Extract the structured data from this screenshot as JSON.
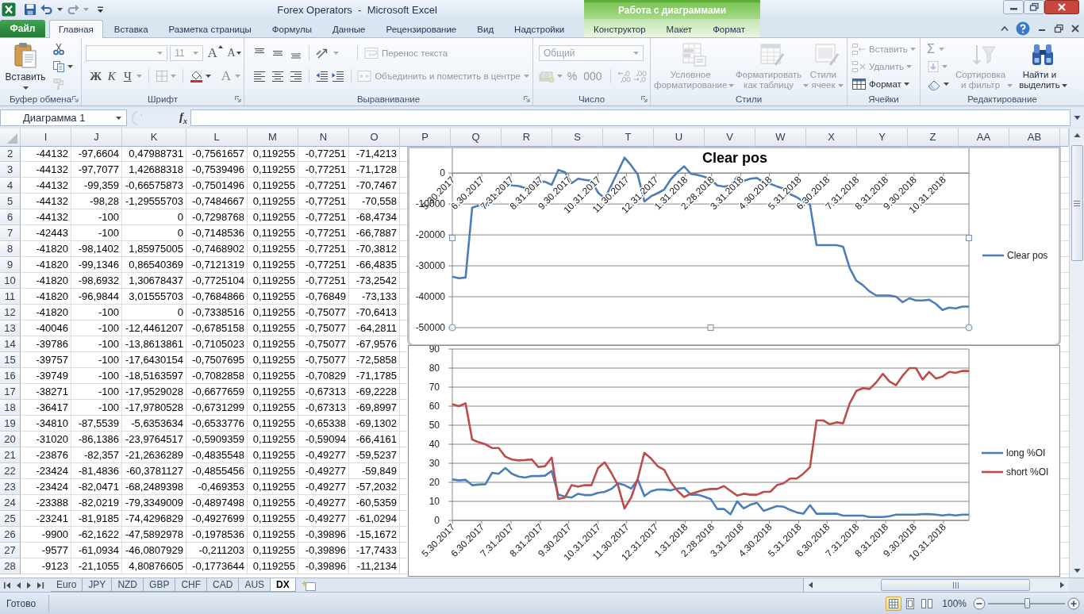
{
  "window": {
    "title": "Forex Operators  -  Microsoft Excel"
  },
  "chart_tools": {
    "title": "Работа с диаграммами",
    "tabs": [
      {
        "label": "Конструктор",
        "selected": false
      },
      {
        "label": "Макет",
        "selected": false
      },
      {
        "label": "Формат",
        "selected": false
      }
    ]
  },
  "tabs": [
    {
      "label": "Файл",
      "kind": "file",
      "selected": false
    },
    {
      "label": "Главная",
      "kind": "tab",
      "selected": true
    },
    {
      "label": "Вставка",
      "kind": "tab",
      "selected": false
    },
    {
      "label": "Разметка страницы",
      "kind": "tab",
      "selected": false
    },
    {
      "label": "Формулы",
      "kind": "tab",
      "selected": false
    },
    {
      "label": "Данные",
      "kind": "tab",
      "selected": false
    },
    {
      "label": "Рецензирование",
      "kind": "tab",
      "selected": false
    },
    {
      "label": "Вид",
      "kind": "tab",
      "selected": false
    },
    {
      "label": "Надстройки",
      "kind": "tab",
      "selected": false
    }
  ],
  "ribbon": {
    "clipboard": {
      "title": "Буфер обмена",
      "paste": "Вставить"
    },
    "font": {
      "title": "Шрифт",
      "size": {
        "value": "11",
        "disabled": true
      },
      "grow": "A",
      "shrink": "A",
      "styles": [
        {
          "label": "Ж",
          "kind": "bold"
        },
        {
          "label": "К",
          "kind": "italic"
        },
        {
          "label": "Ч",
          "kind": "underline"
        }
      ],
      "font_color_button": {
        "label": "A"
      }
    },
    "alignment": {
      "title": "Выравнивание",
      "wrap": {
        "label": "Перенос текста",
        "disabled": true
      },
      "merge": {
        "label": "Объединить и поместить в центре",
        "disabled": true
      }
    },
    "number": {
      "title": "Число",
      "format": {
        "value": "Общий",
        "disabled": true
      },
      "percent": {
        "label": "%",
        "disabled": true
      },
      "thousands": {
        "label": "000",
        "disabled": true
      }
    },
    "styles": {
      "title": "Стили",
      "buttons": [
        {
          "label": "Условное форматирование",
          "kind": "conditional",
          "disabled": true
        },
        {
          "label": "Форматировать как таблицу",
          "kind": "table",
          "disabled": true
        },
        {
          "label": "Стили ячеек",
          "kind": "cell_styles",
          "disabled": true
        }
      ]
    },
    "cells": {
      "title": "Ячейки",
      "buttons": [
        {
          "label": "Вставить",
          "kind": "insert",
          "disabled": true
        },
        {
          "label": "Удалить",
          "kind": "delete",
          "disabled": true
        },
        {
          "label": "Формат",
          "kind": "format",
          "disabled": false
        }
      ]
    },
    "editing": {
      "title": "Редактирование",
      "sum": {
        "label": "Σ",
        "disabled": true
      },
      "buttons": [
        {
          "label": "Сортировка и фильтр",
          "kind": "sort",
          "disabled": true
        },
        {
          "label": "Найти и выделить",
          "kind": "find",
          "disabled": false
        }
      ]
    }
  },
  "formula_bar": {
    "name_box": "Диаграмма 1",
    "function_label": "f$_{x}$"
  },
  "sheet": {
    "columns": [
      "I",
      "J",
      "K",
      "L",
      "M",
      "N",
      "O",
      "P",
      "Q",
      "R",
      "S",
      "T",
      "U",
      "V",
      "W",
      "X",
      "Y",
      "Z",
      "AA",
      "AB"
    ],
    "rows": [
      {
        "header": "2",
        "cells": [
          "-44132",
          "-97,6604",
          "0,47988731",
          "-0,7561657",
          "0,119255",
          "-0,77251",
          "-71,4213"
        ]
      },
      {
        "header": "3",
        "cells": [
          "-44132",
          "-97,7077",
          "1,42688318",
          "-0,7539496",
          "0,119255",
          "-0,77251",
          "-71,1728"
        ]
      },
      {
        "header": "4",
        "cells": [
          "-44132",
          "-99,359",
          "-0,66575873",
          "-0,7501496",
          "0,119255",
          "-0,77251",
          "-70,7467"
        ]
      },
      {
        "header": "5",
        "cells": [
          "-44132",
          "-98,28",
          "-1,29555703",
          "-0,7484667",
          "0,119255",
          "-0,77251",
          "-70,558"
        ]
      },
      {
        "header": "6",
        "cells": [
          "-44132",
          "-100",
          "0",
          "-0,7298768",
          "0,119255",
          "-0,77251",
          "-68,4734"
        ]
      },
      {
        "header": "7",
        "cells": [
          "-42443",
          "-100",
          "0",
          "-0,7148536",
          "0,119255",
          "-0,77251",
          "-66,7887"
        ]
      },
      {
        "header": "8",
        "cells": [
          "-41820",
          "-98,1402",
          "1,85975005",
          "-0,7468902",
          "0,119255",
          "-0,77251",
          "-70,3812"
        ]
      },
      {
        "header": "9",
        "cells": [
          "-41820",
          "-99,1346",
          "0,86540369",
          "-0,7121319",
          "0,119255",
          "-0,77251",
          "-66,4835"
        ]
      },
      {
        "header": "10",
        "cells": [
          "-41820",
          "-98,6932",
          "1,30678437",
          "-0,7725104",
          "0,119255",
          "-0,77251",
          "-73,2542"
        ]
      },
      {
        "header": "11",
        "cells": [
          "-41820",
          "-96,9844",
          "3,01555703",
          "-0,7684866",
          "0,119255",
          "-0,76849",
          "-73,133"
        ]
      },
      {
        "header": "12",
        "cells": [
          "-41820",
          "-100",
          "0",
          "-0,7338516",
          "0,119255",
          "-0,75077",
          "-70,6413"
        ]
      },
      {
        "header": "13",
        "cells": [
          "-40046",
          "-100",
          "-12,4461207",
          "-0,6785158",
          "0,119255",
          "-0,75077",
          "-64,2811"
        ]
      },
      {
        "header": "14",
        "cells": [
          "-39786",
          "-100",
          "-13,8613861",
          "-0,7105023",
          "0,119255",
          "-0,75077",
          "-67,9576"
        ]
      },
      {
        "header": "15",
        "cells": [
          "-39757",
          "-100",
          "-17,6430154",
          "-0,7507695",
          "0,119255",
          "-0,75077",
          "-72,5858"
        ]
      },
      {
        "header": "16",
        "cells": [
          "-39749",
          "-100",
          "-18,5163597",
          "-0,7082858",
          "0,119255",
          "-0,70829",
          "-71,1785"
        ]
      },
      {
        "header": "17",
        "cells": [
          "-38271",
          "-100",
          "-17,9529028",
          "-0,6677659",
          "0,119255",
          "-0,67313",
          "-69,2228"
        ]
      },
      {
        "header": "18",
        "cells": [
          "-36417",
          "-100",
          "-17,9780528",
          "-0,6731299",
          "0,119255",
          "-0,67313",
          "-69,8997"
        ]
      },
      {
        "header": "19",
        "cells": [
          "-34810",
          "-87,5539",
          "-5,6353634",
          "-0,6533776",
          "0,119255",
          "-0,65338",
          "-69,1302"
        ]
      },
      {
        "header": "20",
        "cells": [
          "-31020",
          "-86,1386",
          "-23,9764517",
          "-0,5909359",
          "0,119255",
          "-0,59094",
          "-66,4161"
        ]
      },
      {
        "header": "21",
        "cells": [
          "-23876",
          "-82,357",
          "-21,2636289",
          "-0,4835548",
          "0,119255",
          "-0,49277",
          "-59,5237"
        ]
      },
      {
        "header": "22",
        "cells": [
          "-23424",
          "-81,4836",
          "-60,3781127",
          "-0,4855456",
          "0,119255",
          "-0,49277",
          "-59,849"
        ]
      },
      {
        "header": "23",
        "cells": [
          "-23424",
          "-82,0471",
          "-68,2489398",
          "-0,469353",
          "0,119255",
          "-0,49277",
          "-57,2032"
        ]
      },
      {
        "header": "24",
        "cells": [
          "-23388",
          "-82,0219",
          "-79,3349009",
          "-0,4897498",
          "0,119255",
          "-0,49277",
          "-60,5359"
        ]
      },
      {
        "header": "25",
        "cells": [
          "-23241",
          "-81,9185",
          "-74,4296829",
          "-0,4927699",
          "0,119255",
          "-0,49277",
          "-61,0294"
        ]
      },
      {
        "header": "26",
        "cells": [
          "-9900",
          "-62,1622",
          "-47,5892978",
          "-0,1978536",
          "0,119255",
          "-0,39896",
          "-15,1672"
        ]
      },
      {
        "header": "27",
        "cells": [
          "-9577",
          "-61,0934",
          "-46,0807929",
          "-0,211203",
          "0,119255",
          "-0,39896",
          "-17,7433"
        ]
      },
      {
        "header": "28",
        "cells": [
          "-9123",
          "-21,1055",
          "4,80876605",
          "-0,1773644",
          "0,119255",
          "-0,39896",
          "-11,2134"
        ]
      }
    ],
    "charts": [
      {
        "selected": true,
        "chart_data": {
          "type": "line",
          "title": "Clear pos",
          "grid": true,
          "legend": "right",
          "x": [
            "2017-05-30",
            "2017-06-06",
            "2017-06-13",
            "2017-06-20",
            "2017-06-27",
            "2017-07-04",
            "2017-07-11",
            "2017-07-18",
            "2017-07-25",
            "2017-08-01",
            "2017-08-08",
            "2017-08-15",
            "2017-08-22",
            "2017-08-29",
            "2017-09-05",
            "2017-09-12",
            "2017-09-19",
            "2017-09-26",
            "2017-10-03",
            "2017-10-10",
            "2017-10-17",
            "2017-10-24",
            "2017-10-31",
            "2017-11-07",
            "2017-11-14",
            "2017-11-21",
            "2017-11-28",
            "2017-12-05",
            "2017-12-12",
            "2017-12-19",
            "2017-12-26",
            "2018-01-02",
            "2018-01-09",
            "2018-01-16",
            "2018-01-23",
            "2018-01-30",
            "2018-02-06",
            "2018-02-13",
            "2018-02-20",
            "2018-02-27",
            "2018-03-06",
            "2018-03-13",
            "2018-03-20",
            "2018-03-27",
            "2018-04-03",
            "2018-04-10",
            "2018-04-17",
            "2018-04-24",
            "2018-05-01",
            "2018-05-08",
            "2018-05-15",
            "2018-05-22",
            "2018-05-29",
            "2018-06-05",
            "2018-06-12",
            "2018-06-19",
            "2018-06-26",
            "2018-07-03",
            "2018-07-10",
            "2018-07-17",
            "2018-07-24",
            "2018-07-31",
            "2018-08-07",
            "2018-08-14",
            "2018-08-21",
            "2018-08-28",
            "2018-09-04",
            "2018-09-11",
            "2018-09-18",
            "2018-09-25",
            "2018-10-02",
            "2018-10-09",
            "2018-10-16",
            "2018-10-23",
            "2018-10-30",
            "2018-11-06",
            "2018-11-13",
            "2018-11-20",
            "2018-11-27"
          ],
          "xlim": [
            "2017-05-30",
            "2018-11-27"
          ],
          "xticks": [
            {
              "value": "2017-05-30",
              "label": "5.30.2017"
            },
            {
              "value": "2017-06-30",
              "label": "6.30.2017"
            },
            {
              "value": "2017-07-31",
              "label": "7.31.2017"
            },
            {
              "value": "2017-08-31",
              "label": "8.31.2017"
            },
            {
              "value": "2017-09-30",
              "label": "9.30.2017"
            },
            {
              "value": "2017-10-31",
              "label": "10.31.2017"
            },
            {
              "value": "2017-11-30",
              "label": "11.30.2017"
            },
            {
              "value": "2017-12-31",
              "label": "12.31.2017"
            },
            {
              "value": "2018-01-31",
              "label": "1.31.2018"
            },
            {
              "value": "2018-02-28",
              "label": "2.28.2018"
            },
            {
              "value": "2018-03-31",
              "label": "3.31.2018"
            },
            {
              "value": "2018-04-30",
              "label": "4.30.2018"
            },
            {
              "value": "2018-05-31",
              "label": "5.31.2018"
            },
            {
              "value": "2018-06-30",
              "label": "6.30.2018"
            },
            {
              "value": "2018-07-31",
              "label": "7.31.2018"
            },
            {
              "value": "2018-08-31",
              "label": "8.31.2018"
            },
            {
              "value": "2018-09-30",
              "label": "9.30.2018"
            },
            {
              "value": "2018-10-31",
              "label": "10.31.2018"
            }
          ],
          "ylim": [
            -50000,
            8000
          ],
          "yticks": [
            -50000,
            -40000,
            -30000,
            -20000,
            -10000,
            0
          ],
          "series": [
            {
              "name": "Clear pos",
              "color": "#4a7ebb",
              "values": [
                -33500,
                -34000,
                -33800,
                -11200,
                -10500,
                -10800,
                -7000,
                -7300,
                -2800,
                -4000,
                -4200,
                -4800,
                -5000,
                -2800,
                -2800,
                -3800,
                1000,
                300,
                -3300,
                -1800,
                -2200,
                -2500,
                -6300,
                -8200,
                -4000,
                500,
                5000,
                2500,
                -500,
                -9200,
                -7500,
                -6500,
                -5300,
                -2000,
                300,
                2200,
                -200,
                -600,
                -1200,
                -2000,
                -4000,
                -4400,
                -4000,
                -1300,
                -2500,
                -1800,
                -1600,
                -3000,
                -3500,
                -4300,
                -5000,
                -6800,
                -7800,
                -9200,
                -10200,
                -23300,
                -23300,
                -23300,
                -23300,
                -23800,
                -30800,
                -34800,
                -36300,
                -38300,
                -39600,
                -39600,
                -39600,
                -40000,
                -41800,
                -40500,
                -41200,
                -41200,
                -41000,
                -42300,
                -44300,
                -43500,
                -43800,
                -43200,
                -43200
              ]
            }
          ]
        }
      },
      {
        "selected": false,
        "chart_data": {
          "type": "line",
          "grid": true,
          "legend": "right",
          "x": [
            "2017-05-30",
            "2017-06-06",
            "2017-06-13",
            "2017-06-20",
            "2017-06-27",
            "2017-07-04",
            "2017-07-11",
            "2017-07-18",
            "2017-07-25",
            "2017-08-01",
            "2017-08-08",
            "2017-08-15",
            "2017-08-22",
            "2017-08-29",
            "2017-09-05",
            "2017-09-12",
            "2017-09-19",
            "2017-09-26",
            "2017-10-03",
            "2017-10-10",
            "2017-10-17",
            "2017-10-24",
            "2017-10-31",
            "2017-11-07",
            "2017-11-14",
            "2017-11-21",
            "2017-11-28",
            "2017-12-05",
            "2017-12-12",
            "2017-12-19",
            "2017-12-26",
            "2018-01-02",
            "2018-01-09",
            "2018-01-16",
            "2018-01-23",
            "2018-01-30",
            "2018-02-06",
            "2018-02-13",
            "2018-02-20",
            "2018-02-27",
            "2018-03-06",
            "2018-03-13",
            "2018-03-20",
            "2018-03-27",
            "2018-04-03",
            "2018-04-10",
            "2018-04-17",
            "2018-04-24",
            "2018-05-01",
            "2018-05-08",
            "2018-05-15",
            "2018-05-22",
            "2018-05-29",
            "2018-06-05",
            "2018-06-12",
            "2018-06-19",
            "2018-06-26",
            "2018-07-03",
            "2018-07-10",
            "2018-07-17",
            "2018-07-24",
            "2018-07-31",
            "2018-08-07",
            "2018-08-14",
            "2018-08-21",
            "2018-08-28",
            "2018-09-04",
            "2018-09-11",
            "2018-09-18",
            "2018-09-25",
            "2018-10-02",
            "2018-10-09",
            "2018-10-16",
            "2018-10-23",
            "2018-10-30",
            "2018-11-06",
            "2018-11-13",
            "2018-11-20",
            "2018-11-27"
          ],
          "xlim": [
            "2017-05-30",
            "2018-11-27"
          ],
          "xticks": [
            {
              "value": "2017-05-30",
              "label": "5.30.2017"
            },
            {
              "value": "2017-06-30",
              "label": "6.30.2017"
            },
            {
              "value": "2017-07-31",
              "label": "7.31.2017"
            },
            {
              "value": "2017-08-31",
              "label": "8.31.2017"
            },
            {
              "value": "2017-09-30",
              "label": "9.30.2017"
            },
            {
              "value": "2017-10-31",
              "label": "10.31.2017"
            },
            {
              "value": "2017-11-30",
              "label": "11.30.2017"
            },
            {
              "value": "2017-12-31",
              "label": "12.31.2017"
            },
            {
              "value": "2018-01-31",
              "label": "1.31.2018"
            },
            {
              "value": "2018-02-28",
              "label": "2.28.2018"
            },
            {
              "value": "2018-03-31",
              "label": "3.31.2018"
            },
            {
              "value": "2018-04-30",
              "label": "4.30.2018"
            },
            {
              "value": "2018-05-31",
              "label": "5.31.2018"
            },
            {
              "value": "2018-06-30",
              "label": "6.30.2018"
            },
            {
              "value": "2018-07-31",
              "label": "7.31.2018"
            },
            {
              "value": "2018-08-31",
              "label": "8.31.2018"
            },
            {
              "value": "2018-09-30",
              "label": "9.30.2018"
            },
            {
              "value": "2018-10-31",
              "label": "10.31.2018"
            }
          ],
          "ylim": [
            0,
            90
          ],
          "yticks": [
            0,
            10,
            20,
            30,
            40,
            50,
            60,
            70,
            80,
            90
          ],
          "series": [
            {
              "name": "long %OI",
              "color": "#4a7ebb",
              "values": [
                21.5,
                21,
                21.3,
                18.5,
                18.8,
                19,
                25,
                24.5,
                27.5,
                24.5,
                23,
                22.5,
                23.3,
                23.3,
                23.5,
                26,
                13.5,
                12.5,
                12,
                14,
                13.3,
                13.3,
                14.5,
                15,
                16.5,
                19.5,
                18.5,
                16.7,
                21.5,
                12.8,
                15.3,
                16.2,
                16.2,
                15.8,
                16.8,
                17,
                13.5,
                13.5,
                12.5,
                11.3,
                6,
                6,
                3.2,
                10,
                6.3,
                8.2,
                9.3,
                5,
                6.2,
                7.5,
                7.2,
                5.5,
                4.2,
                3.5,
                8,
                3.5,
                3.5,
                3.5,
                3.5,
                2.5,
                2.5,
                2.5,
                2.5,
                1.8,
                1.8,
                1.8,
                2.2,
                3,
                3,
                3,
                3,
                3.3,
                3.3,
                3,
                2.6,
                3,
                2.6,
                3,
                3
              ]
            },
            {
              "name": "short %OI",
              "color": "#be4b48",
              "values": [
                61,
                60,
                61.5,
                42.5,
                41,
                40,
                38,
                38,
                33.5,
                32,
                31.5,
                31.7,
                32,
                28,
                28.5,
                33,
                11.3,
                12,
                18.5,
                17.7,
                18.5,
                18.5,
                27.5,
                30.5,
                25,
                18.5,
                6.2,
                12,
                22,
                35.5,
                32.5,
                28.5,
                26.5,
                20,
                15.5,
                12.3,
                14,
                15,
                16,
                16.5,
                16.5,
                18,
                15.5,
                13,
                14,
                13.5,
                13.5,
                15,
                15,
                18.5,
                19.5,
                22,
                22,
                24.5,
                28,
                52.5,
                52.5,
                50.5,
                51.5,
                51,
                61.5,
                68,
                69.5,
                69,
                72.5,
                77,
                73,
                71,
                76,
                80,
                80,
                74,
                78,
                74.5,
                75.5,
                78,
                77.5,
                78.5,
                78.5
              ]
            }
          ]
        }
      }
    ]
  },
  "sheet_tabs": [
    {
      "label": "Euro",
      "selected": false
    },
    {
      "label": "JPY",
      "selected": false
    },
    {
      "label": "NZD",
      "selected": false
    },
    {
      "label": "GBP",
      "selected": false
    },
    {
      "label": "CHF",
      "selected": false
    },
    {
      "label": "CAD",
      "selected": false
    },
    {
      "label": "AUS",
      "selected": false
    },
    {
      "label": "DX",
      "selected": true
    }
  ],
  "status_bar": {
    "status": "Готово",
    "views": [
      {
        "kind": "normal",
        "selected": true
      },
      {
        "kind": "page_layout",
        "selected": false
      },
      {
        "kind": "page_break",
        "selected": false
      }
    ],
    "zoom": "100%",
    "zoom_slider": {
      "level": 0.5
    }
  }
}
